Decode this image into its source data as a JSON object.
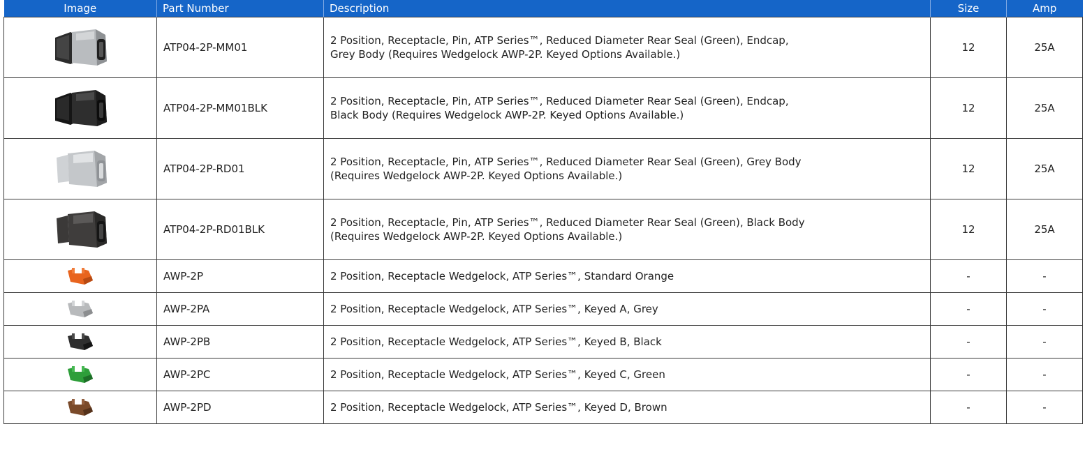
{
  "header": {
    "image": "Image",
    "part_number": "Part Number",
    "description": "Description",
    "size": "Size",
    "amp": "Amp"
  },
  "colors": {
    "header_bg": "#1565c8",
    "border": "#3a3a3a"
  },
  "rows": [
    {
      "icon": "grey-connector-endcap-icon",
      "part": "ATP04-2P-MM01",
      "desc1": "2 Position, Receptacle, Pin, ATP Series™, Reduced Diameter Rear Seal (Green), Endcap,",
      "desc2": "Grey Body (Requires Wedgelock AWP-2P. Keyed Options Available.)",
      "size": "12",
      "amp": "25A"
    },
    {
      "icon": "black-connector-endcap-icon",
      "part": "ATP04-2P-MM01BLK",
      "desc1": "2 Position, Receptacle, Pin, ATP Series™, Reduced Diameter Rear Seal (Green), Endcap,",
      "desc2": "Black Body (Requires Wedgelock AWP-2P. Keyed Options Available.)",
      "size": "12",
      "amp": "25A"
    },
    {
      "icon": "grey-connector-icon",
      "part": "ATP04-2P-RD01",
      "desc1": "2 Position, Receptacle, Pin, ATP Series™, Reduced Diameter Rear Seal (Green), Grey Body",
      "desc2": "(Requires Wedgelock AWP-2P. Keyed Options Available.)",
      "size": "12",
      "amp": "25A"
    },
    {
      "icon": "black-connector-icon",
      "part": "ATP04-2P-RD01BLK",
      "desc1": "2 Position, Receptacle, Pin, ATP Series™, Reduced Diameter Rear Seal (Green), Black Body",
      "desc2": "(Requires Wedgelock AWP-2P. Keyed Options Available.)",
      "size": "12",
      "amp": "25A"
    },
    {
      "icon": "orange-wedgelock-icon",
      "part": "AWP-2P",
      "desc1": "2 Position, Receptacle Wedgelock, ATP Series™, Standard Orange",
      "size": "-",
      "amp": "-"
    },
    {
      "icon": "grey-wedgelock-icon",
      "part": "AWP-2PA",
      "desc1": "2 Position, Receptacle Wedgelock, ATP Series™, Keyed A, Grey",
      "size": "-",
      "amp": "-"
    },
    {
      "icon": "black-wedgelock-icon",
      "part": "AWP-2PB",
      "desc1": "2 Position, Receptacle Wedgelock, ATP Series™, Keyed B, Black",
      "size": "-",
      "amp": "-"
    },
    {
      "icon": "green-wedgelock-icon",
      "part": "AWP-2PC",
      "desc1": "2 Position, Receptacle Wedgelock, ATP Series™, Keyed C, Green",
      "size": "-",
      "amp": "-"
    },
    {
      "icon": "brown-wedgelock-icon",
      "part": "AWP-2PD",
      "desc1": "2 Position, Receptacle Wedgelock, ATP Series™, Keyed D, Brown",
      "size": "-",
      "amp": "-"
    }
  ]
}
